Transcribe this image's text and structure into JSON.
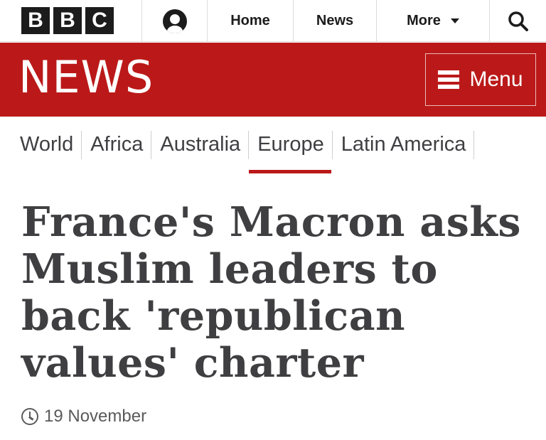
{
  "header": {
    "logo_letters": [
      "B",
      "B",
      "C"
    ],
    "nav": {
      "account_icon": "account-icon",
      "home_label": "Home",
      "news_label": "News",
      "more_label": "More",
      "more_icon": "chevron-down-icon",
      "search_icon": "search-icon"
    }
  },
  "news_band": {
    "title": "NEWS",
    "menu_label": "Menu",
    "menu_icon": "hamburger-icon",
    "color": "#bb1919"
  },
  "sections": {
    "items": [
      {
        "label": "World"
      },
      {
        "label": "Africa"
      },
      {
        "label": "Australia"
      },
      {
        "label": "Europe"
      },
      {
        "label": "Latin America"
      }
    ],
    "active": "Europe",
    "accent_color": "#bb1919"
  },
  "article": {
    "headline": "France's Macron asks Muslim leaders to back 'republican values' charter",
    "date": "19 November",
    "date_icon": "clock-icon"
  }
}
